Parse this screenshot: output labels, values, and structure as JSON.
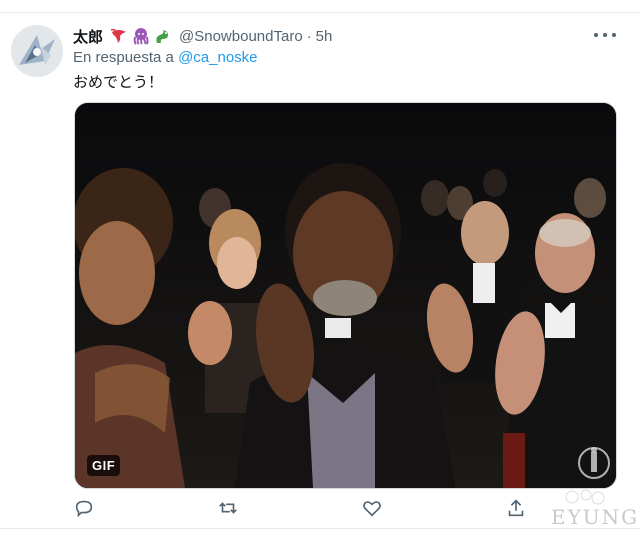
{
  "tweet": {
    "display_name": "太郎",
    "handle": "@SnowboundTaro",
    "separator": "·",
    "time": "5h",
    "reply_prefix": "En respuesta a",
    "reply_to": "@ca_noske",
    "text": "おめでとう！",
    "badge_emojis": [
      "lobster-emoji",
      "octopus-emoji",
      "dragon-emoji"
    ]
  },
  "media": {
    "type": "gif",
    "badge_label": "GIF"
  },
  "actions": [
    "reply-icon",
    "retweet-icon",
    "like-icon",
    "share-icon"
  ],
  "watermark": {
    "text": "EYUNG"
  },
  "colors": {
    "link": "#1d9bf0",
    "secondary_text": "#536471",
    "primary_text": "#0f1419",
    "border": "#cfd9de"
  }
}
